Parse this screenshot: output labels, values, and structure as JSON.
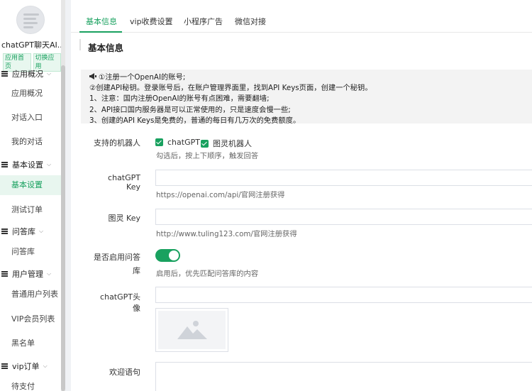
{
  "sidebar": {
    "app_name": "chatGPT聊天AI...",
    "app_links": [
      "应用首页",
      "切换应用"
    ],
    "groups": [
      {
        "label": "应用概况",
        "items": [
          "应用概况",
          "对话入口",
          "我的对话"
        ]
      },
      {
        "label": "基本设置",
        "items": [
          "基本设置",
          "测试订单"
        ]
      },
      {
        "label": "问答库",
        "items": [
          "问答库"
        ]
      },
      {
        "label": "用户管理",
        "items": [
          "普通用户列表",
          "VIP会员列表",
          "黑名单"
        ]
      },
      {
        "label": "vip订单",
        "items": [
          "待支付"
        ]
      }
    ],
    "active_item": "基本设置"
  },
  "tabs": [
    "基本信息",
    "vip收费设置",
    "小程序广告",
    "微信对接"
  ],
  "active_tab": "基本信息",
  "section_title": "基本信息",
  "notice": {
    "lines": [
      "①注册一个OpenAI的账号;",
      "②创建API秘钥。登录账号后，在账户管理界面里，找到API Keys页面，创建一个秘钥。",
      "1、注意：国内注册OpenAI的账号有点困难，需要翻墙;",
      "2、API接口国内服务器是可以正常使用的，只是速度会慢一些;",
      "3、创建的API Keys是免费的，普通的每日有几万次的免费额度。"
    ]
  },
  "form": {
    "robots": {
      "label": "支持的机器人",
      "options": [
        "chatGPT",
        "图灵机器人"
      ],
      "hint": "勾选后，按上下顺序，触发回答"
    },
    "chatgpt_key": {
      "label": "chatGPT Key",
      "value": "",
      "hint": "https://openai.com/api/官网注册获得"
    },
    "tuling_key": {
      "label": "图灵 Key",
      "value": "",
      "hint": "http://www.tuling123.com/官网注册获得"
    },
    "qa_enable": {
      "label_line1": "是否启用问答",
      "label_line2": "库",
      "on": true,
      "hint": "启用后，优先匹配问答库的内容"
    },
    "avatar": {
      "label": "chatGPT头像",
      "value": ""
    },
    "welcome": {
      "label": "欢迎语句",
      "value": ""
    }
  },
  "colors": {
    "accent": "#19a15f",
    "notice_bg": "#f3f3f3"
  }
}
